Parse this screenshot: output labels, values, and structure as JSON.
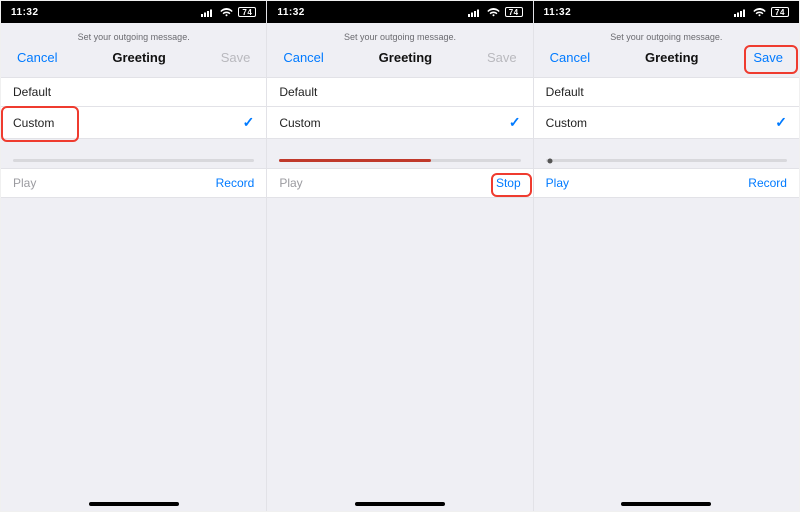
{
  "status_time": "11:32",
  "battery": "74",
  "subtitle": "Set your outgoing message.",
  "title": "Greeting",
  "cancel": "Cancel",
  "save": "Save",
  "option_default": "Default",
  "option_custom": "Custom",
  "play": "Play",
  "record": "Record",
  "stop": "Stop",
  "screens": [
    {
      "save_enabled": false,
      "progress": 0,
      "play_enabled": false,
      "right_action": "record",
      "show_knob": false,
      "highlight": "custom"
    },
    {
      "save_enabled": false,
      "progress": 0.63,
      "play_enabled": false,
      "right_action": "stop",
      "show_knob": false,
      "highlight": "stop"
    },
    {
      "save_enabled": true,
      "progress": 0,
      "play_enabled": true,
      "right_action": "record",
      "show_knob": true,
      "highlight": "save"
    }
  ]
}
